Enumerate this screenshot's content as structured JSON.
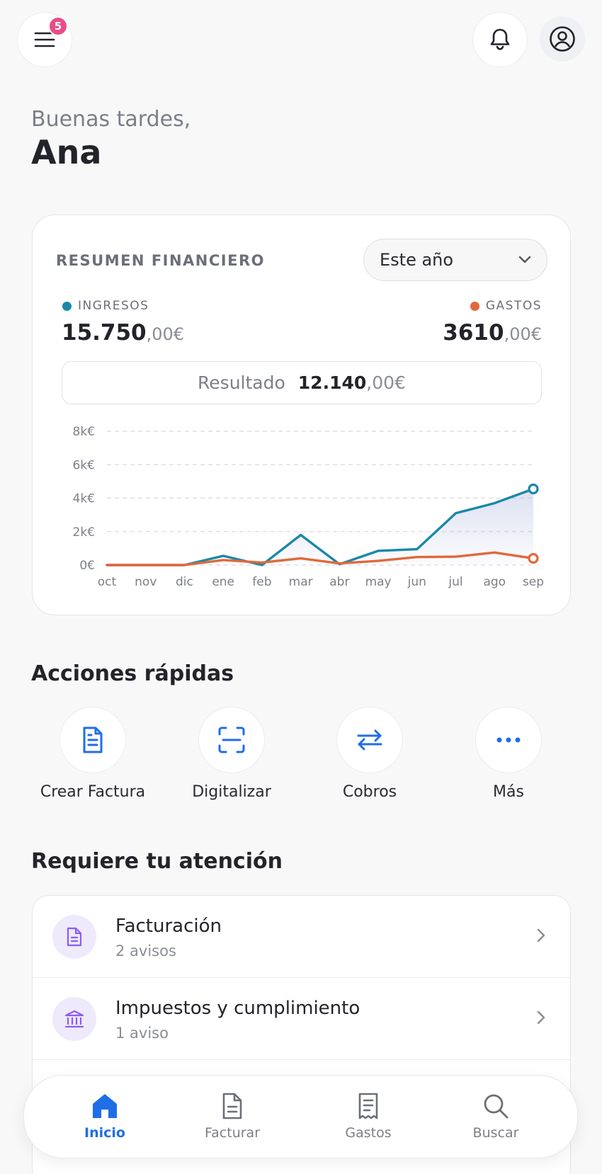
{
  "header": {
    "notification_count": "5",
    "icons": {
      "menu": "menu-icon",
      "bell": "bell-icon",
      "profile": "profile-icon"
    }
  },
  "greeting": {
    "salutation": "Buenas tardes,",
    "name": "Ana"
  },
  "summary": {
    "title": "RESUMEN FINANCIERO",
    "period": "Este año",
    "income": {
      "label": "INGRESOS",
      "whole": "15.750",
      "cents": ",00€",
      "color": "#1a88a8"
    },
    "expenses": {
      "label": "GASTOS",
      "whole": "3610",
      "cents": ",00€",
      "color": "#e0693a"
    },
    "result": {
      "label": "Resultado",
      "whole": "12.140",
      "cents": ",00€"
    }
  },
  "chart_data": {
    "type": "line",
    "x": [
      "oct",
      "nov",
      "dic",
      "ene",
      "feb",
      "mar",
      "abr",
      "may",
      "jun",
      "jul",
      "ago",
      "sep"
    ],
    "y_ticks": [
      "8k€",
      "6k€",
      "4k€",
      "2k€",
      "0€"
    ],
    "ylim": [
      0,
      8000
    ],
    "grid": true,
    "series": [
      {
        "name": "INGRESOS",
        "color": "#1a88a8",
        "values": [
          0,
          0,
          0,
          550,
          0,
          1800,
          50,
          850,
          950,
          3100,
          3700,
          4550
        ]
      },
      {
        "name": "GASTOS",
        "color": "#e0693a",
        "values": [
          0,
          0,
          0,
          300,
          150,
          400,
          100,
          250,
          480,
          500,
          750,
          400
        ]
      }
    ]
  },
  "quick_actions": {
    "title": "Acciones rápidas",
    "items": [
      {
        "label": "Crear Factura",
        "icon": "invoice-icon"
      },
      {
        "label": "Digitalizar",
        "icon": "scan-icon"
      },
      {
        "label": "Cobros",
        "icon": "transfer-icon"
      },
      {
        "label": "Más",
        "icon": "more-icon"
      }
    ]
  },
  "attention": {
    "title": "Requiere tu atención",
    "items": [
      {
        "title": "Facturación",
        "subtitle": "2 avisos",
        "icon": "document-icon"
      },
      {
        "title": "Impuestos y cumplimiento",
        "subtitle": "1 aviso",
        "icon": "bank-icon"
      }
    ]
  },
  "bottom_nav": {
    "items": [
      {
        "label": "Inicio",
        "icon": "home-icon",
        "active": true
      },
      {
        "label": "Facturar",
        "icon": "invoice-icon",
        "active": false
      },
      {
        "label": "Gastos",
        "icon": "receipt-icon",
        "active": false
      },
      {
        "label": "Buscar",
        "icon": "search-icon",
        "active": false
      }
    ],
    "accent": "#1f6ee6"
  }
}
